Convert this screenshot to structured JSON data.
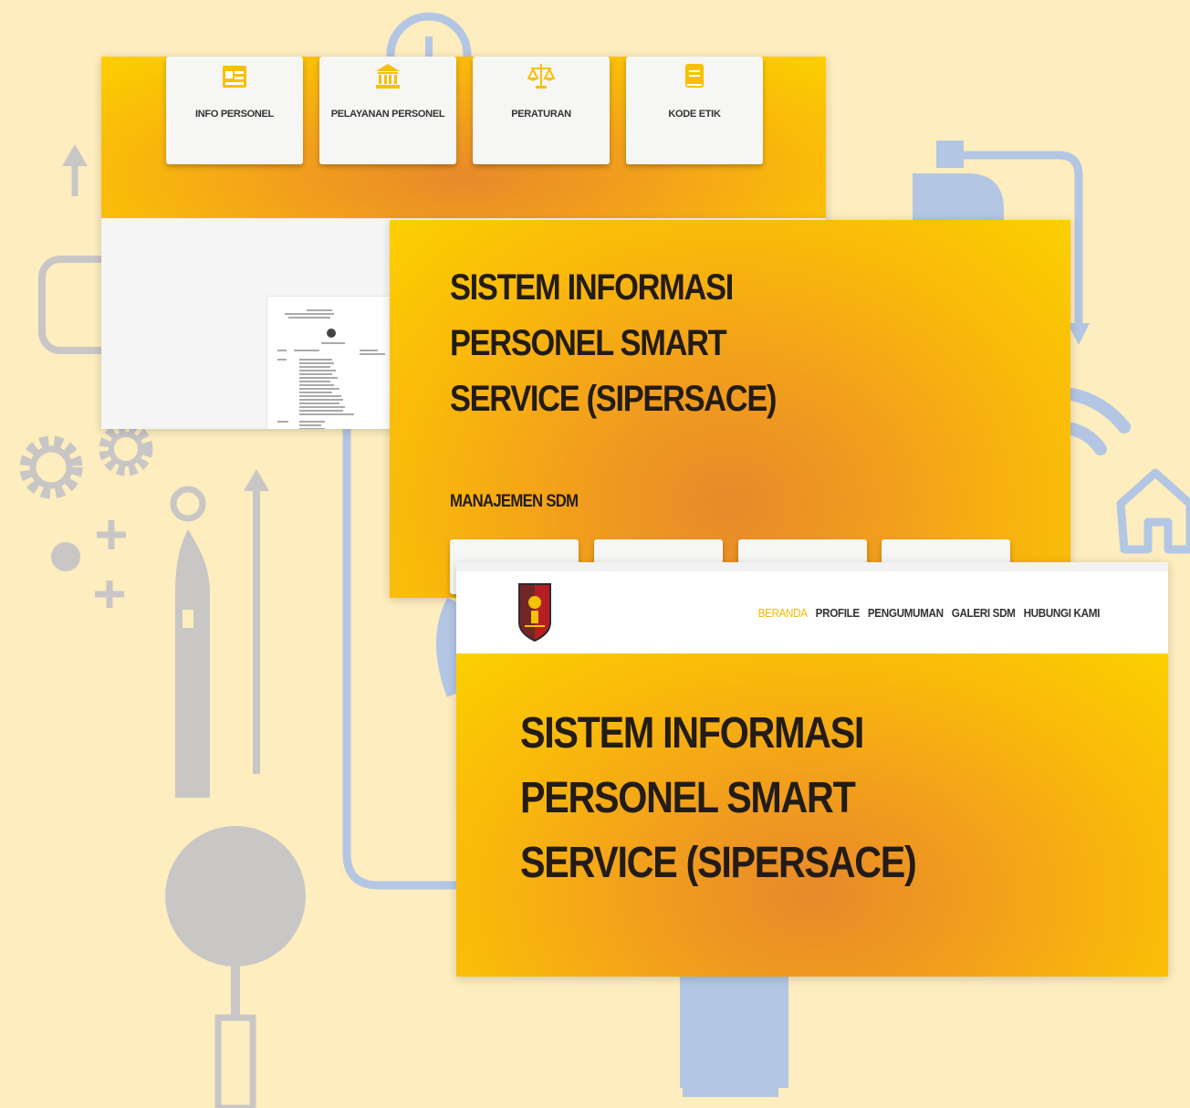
{
  "colors": {
    "background": "#fdedbf",
    "decor_blue": "#b3c6e4",
    "decor_grey": "#c9c6c6",
    "nav_active": "#f5b800",
    "hero_text": "#231c16"
  },
  "top_panel": {
    "cards": [
      {
        "label": "INFO PERSONEL",
        "icon": "id-card-icon"
      },
      {
        "label": "PELAYANAN PERSONEL",
        "icon": "bank-building-icon"
      },
      {
        "label": "PERATURAN",
        "icon": "scales-icon"
      },
      {
        "label": "KODE ETIK",
        "icon": "book-icon"
      }
    ]
  },
  "middle_panel": {
    "title_lines": [
      "SISTEM INFORMASI",
      "PERSONEL SMART",
      "SERVICE (SIPERSACE)"
    ],
    "section_heading": "MANAJEMEN SDM"
  },
  "front_panel": {
    "nav": {
      "items": [
        "BERANDA",
        "PROFILE",
        "PENGUMUMAN",
        "GALERI SDM",
        "HUBUNGI KAMI"
      ],
      "active": "BERANDA"
    },
    "title_lines": [
      "SISTEM INFORMASI",
      "PERSONEL SMART",
      "SERVICE (SIPERSACE)"
    ]
  }
}
